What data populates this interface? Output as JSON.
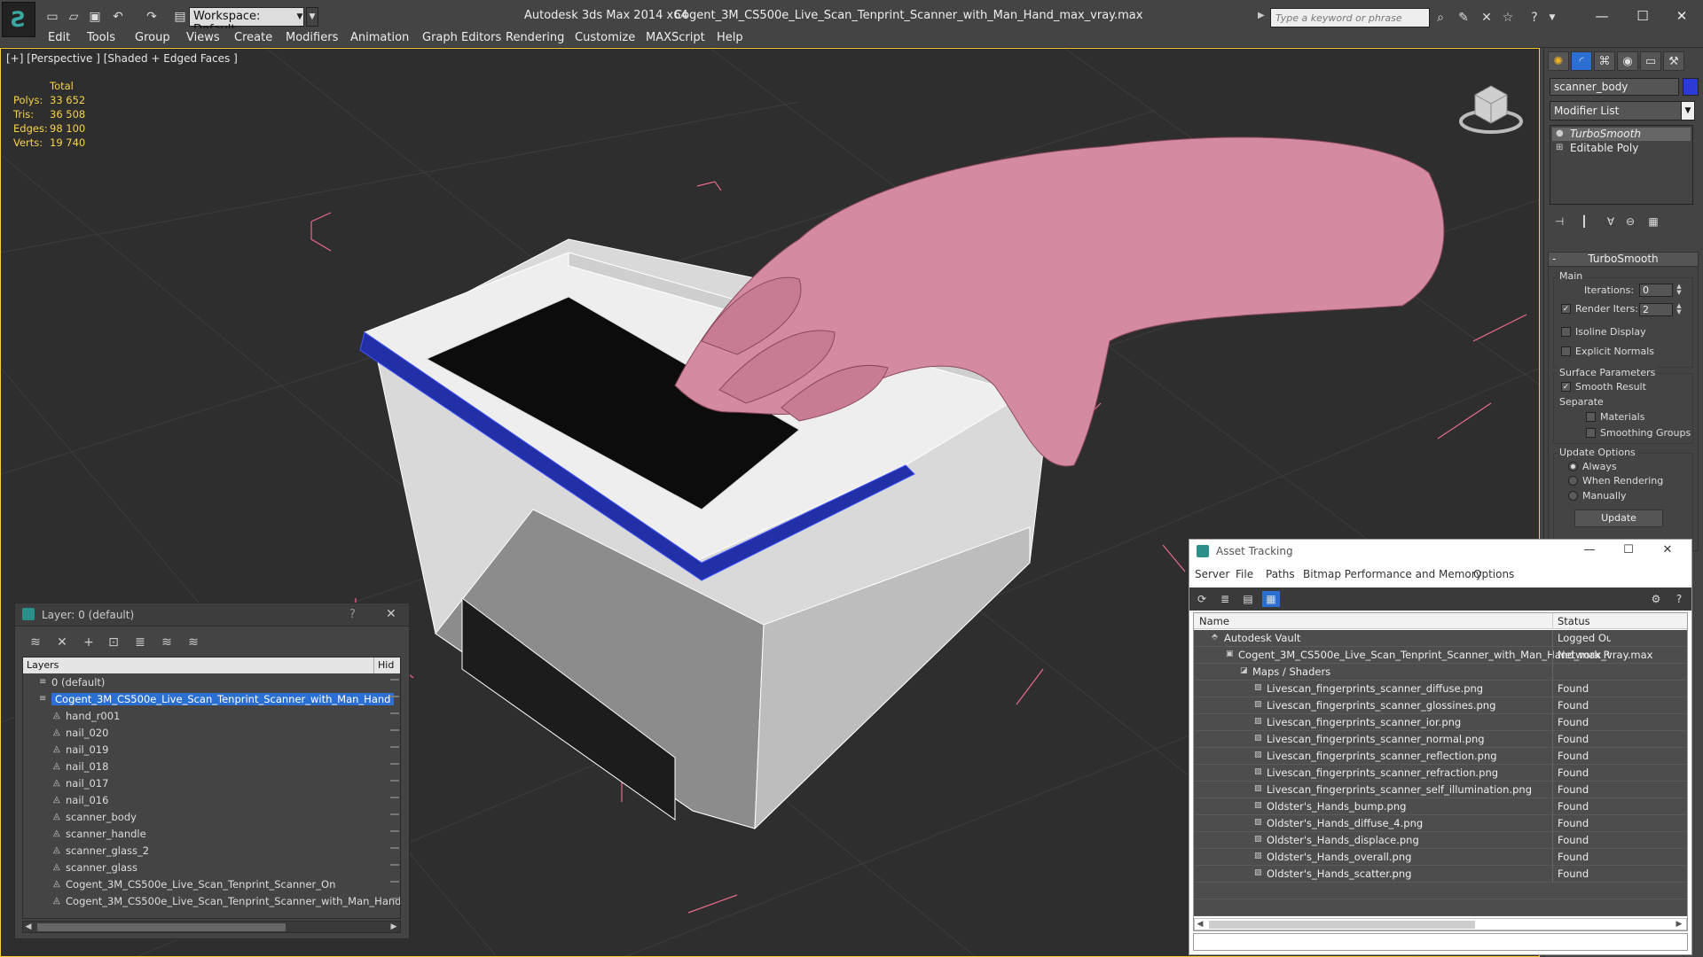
{
  "window": {
    "app_title": "Autodesk 3ds Max  2014 x64",
    "document": "Cogent_3M_CS500e_Live_Scan_Tenprint_Scanner_with_Man_Hand_max_vray.max",
    "workspace": "Workspace: Default",
    "search_placeholder": "Type a keyword or phrase"
  },
  "menu": [
    "Edit",
    "Tools",
    "Group",
    "Views",
    "Create",
    "Modifiers",
    "Animation",
    "Graph Editors",
    "Rendering",
    "Customize",
    "MAXScript",
    "Help"
  ],
  "viewport": {
    "label": "[+] [Perspective ] [Shaded + Edged Faces ]",
    "stats": {
      "header": "Total",
      "rows": [
        {
          "key": "Polys:",
          "value": "33 652"
        },
        {
          "key": "Tris:",
          "value": "36 508"
        },
        {
          "key": "Edges:",
          "value": "98 100"
        },
        {
          "key": "Verts:",
          "value": "19 740"
        }
      ]
    }
  },
  "command_panel": {
    "object_name": "scanner_body",
    "object_color": "#2c3bd6",
    "modifier_list": "Modifier List",
    "stack": [
      "TurboSmooth",
      "Editable Poly"
    ],
    "rollout_title": "TurboSmooth",
    "main_label": "Main",
    "iterations_label": "Iterations:",
    "iterations_value": "0",
    "render_iters_label": "Render Iters:",
    "render_iters_value": "2",
    "isoline_label": "Isoline Display",
    "explicit_label": "Explicit Normals",
    "surface_label": "Surface Parameters",
    "smooth_result_label": "Smooth Result",
    "separate_label": "Separate",
    "materials_label": "Materials",
    "smoothing_groups_label": "Smoothing Groups",
    "update_options_label": "Update Options",
    "always_label": "Always",
    "when_rendering_label": "When Rendering",
    "manually_label": "Manually",
    "update_button": "Update"
  },
  "layer_window": {
    "title": "Layer: 0 (default)",
    "help": "?",
    "column_layers": "Layers",
    "column_hide": "Hid",
    "rows": [
      {
        "label": "0 (default)",
        "level": 0,
        "selected": false
      },
      {
        "label": "Cogent_3M_CS500e_Live_Scan_Tenprint_Scanner_with_Man_Hand",
        "level": 0,
        "selected": true
      },
      {
        "label": "hand_r001",
        "level": 1,
        "selected": false
      },
      {
        "label": "nail_020",
        "level": 1,
        "selected": false
      },
      {
        "label": "nail_019",
        "level": 1,
        "selected": false
      },
      {
        "label": "nail_018",
        "level": 1,
        "selected": false
      },
      {
        "label": "nail_017",
        "level": 1,
        "selected": false
      },
      {
        "label": "nail_016",
        "level": 1,
        "selected": false
      },
      {
        "label": "scanner_body",
        "level": 1,
        "selected": false
      },
      {
        "label": "scanner_handle",
        "level": 1,
        "selected": false
      },
      {
        "label": "scanner_glass_2",
        "level": 1,
        "selected": false
      },
      {
        "label": "scanner_glass",
        "level": 1,
        "selected": false
      },
      {
        "label": "Cogent_3M_CS500e_Live_Scan_Tenprint_Scanner_On",
        "level": 1,
        "selected": false
      },
      {
        "label": "Cogent_3M_CS500e_Live_Scan_Tenprint_Scanner_with_Man_Hand",
        "level": 1,
        "selected": false
      }
    ]
  },
  "asset_tracking": {
    "title": "Asset Tracking",
    "menu": [
      "Server",
      "File",
      "Paths",
      "Bitmap Performance and Memory",
      "Options"
    ],
    "column_name": "Name",
    "column_status": "Status",
    "rows": [
      {
        "name": "Autodesk Vault",
        "level": 1,
        "status": "Logged Ou"
      },
      {
        "name": "Cogent_3M_CS500e_Live_Scan_Tenprint_Scanner_with_Man_Hand_max_vray.max",
        "level": 2,
        "status": "Network Pa"
      },
      {
        "name": "Maps / Shaders",
        "level": 3,
        "status": ""
      },
      {
        "name": "Livescan_fingerprints_scanner_diffuse.png",
        "level": 4,
        "status": "Found"
      },
      {
        "name": "Livescan_fingerprints_scanner_glossines.png",
        "level": 4,
        "status": "Found"
      },
      {
        "name": "Livescan_fingerprints_scanner_ior.png",
        "level": 4,
        "status": "Found"
      },
      {
        "name": "Livescan_fingerprints_scanner_normal.png",
        "level": 4,
        "status": "Found"
      },
      {
        "name": "Livescan_fingerprints_scanner_reflection.png",
        "level": 4,
        "status": "Found"
      },
      {
        "name": "Livescan_fingerprints_scanner_refraction.png",
        "level": 4,
        "status": "Found"
      },
      {
        "name": "Livescan_fingerprints_scanner_self_illumination.png",
        "level": 4,
        "status": "Found"
      },
      {
        "name": "Oldster's_Hands_bump.png",
        "level": 4,
        "status": "Found"
      },
      {
        "name": "Oldster's_Hands_diffuse_4.png",
        "level": 4,
        "status": "Found"
      },
      {
        "name": "Oldster's_Hands_displace.png",
        "level": 4,
        "status": "Found"
      },
      {
        "name": "Oldster's_Hands_overall.png",
        "level": 4,
        "status": "Found"
      },
      {
        "name": "Oldster's_Hands_scatter.png",
        "level": 4,
        "status": "Found"
      }
    ]
  }
}
